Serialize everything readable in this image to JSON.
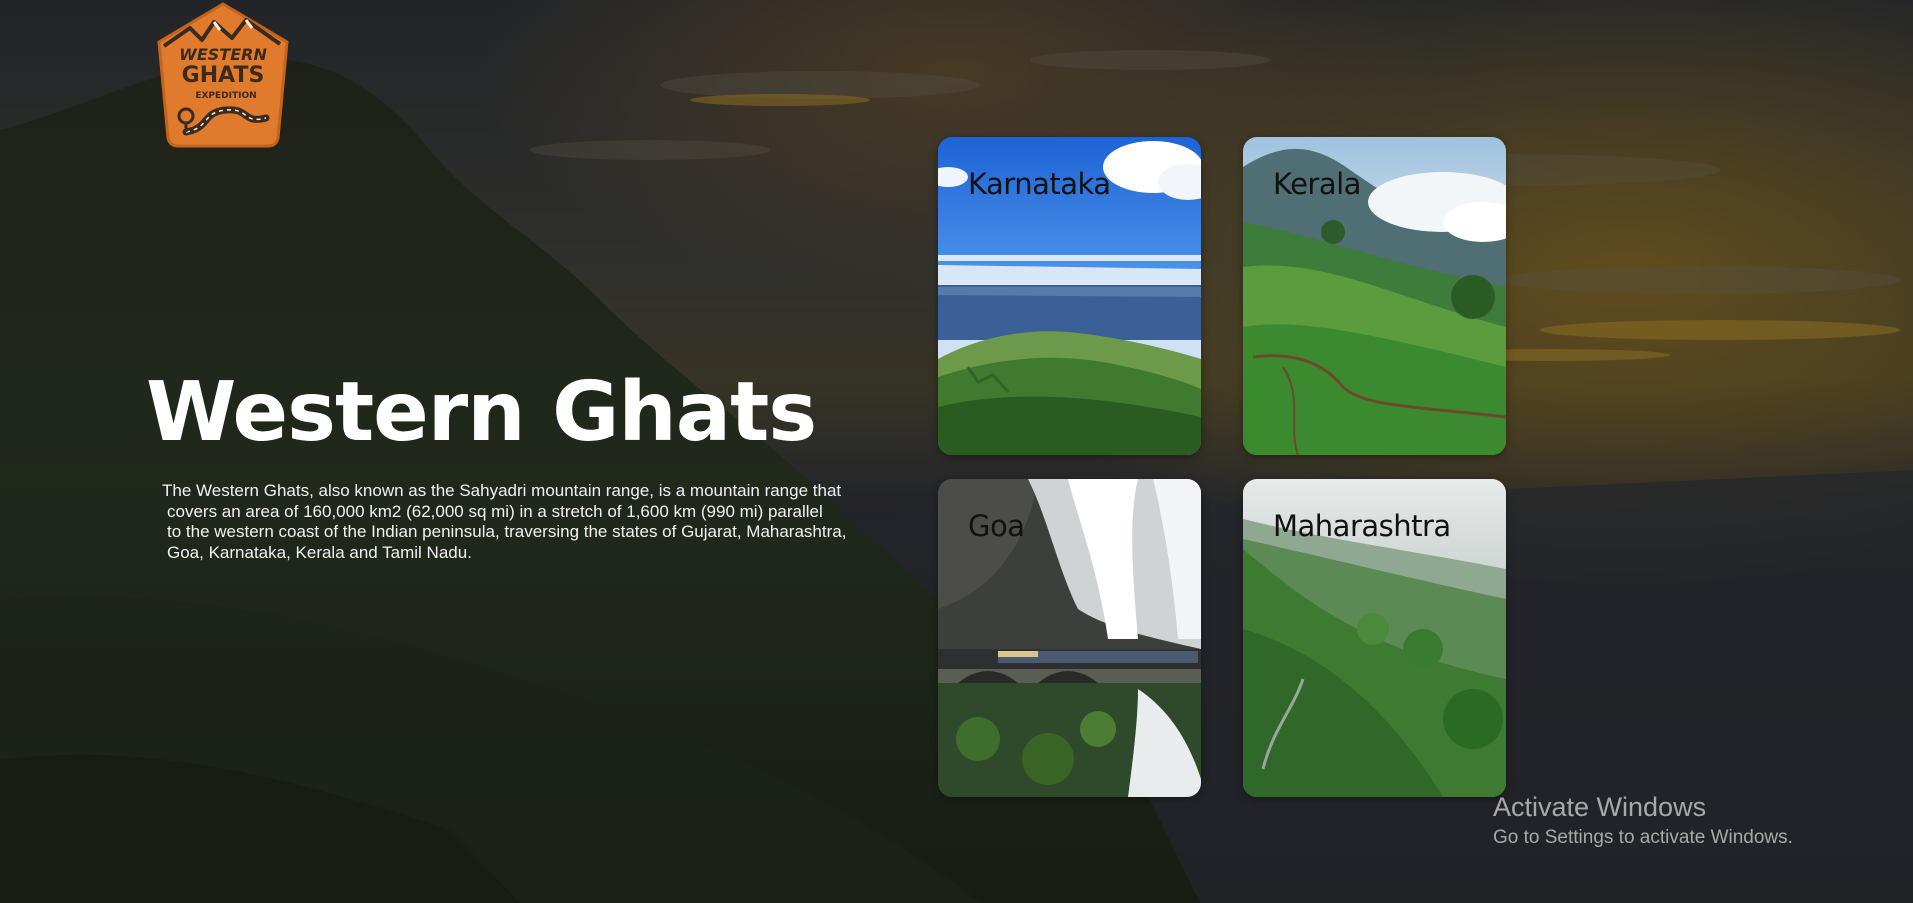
{
  "logo": {
    "line1": "WESTERN",
    "line2": "GHATS",
    "line3": "EXPEDITION",
    "color": "#e07b2e"
  },
  "hero": {
    "title": "Western Ghats",
    "description_lines": [
      "The Western Ghats, also known as the Sahyadri mountain range, is a mountain range that",
      "covers an area of 160,000 km2 (62,000 sq mi) in a stretch of 1,600 km (990 mi) parallel",
      "to the western coast of the Indian peninsula, traversing the states of Gujarat, Maharashtra,",
      "Goa, Karnataka, Kerala and Tamil Nadu."
    ]
  },
  "cards": [
    {
      "id": "karnataka",
      "label": "Karnataka"
    },
    {
      "id": "kerala",
      "label": "Kerala"
    },
    {
      "id": "goa",
      "label": "Goa"
    },
    {
      "id": "maharashtra",
      "label": "Maharashtra"
    }
  ],
  "watermark": {
    "title": "Activate Windows",
    "subtitle": "Go to Settings to activate Windows."
  }
}
